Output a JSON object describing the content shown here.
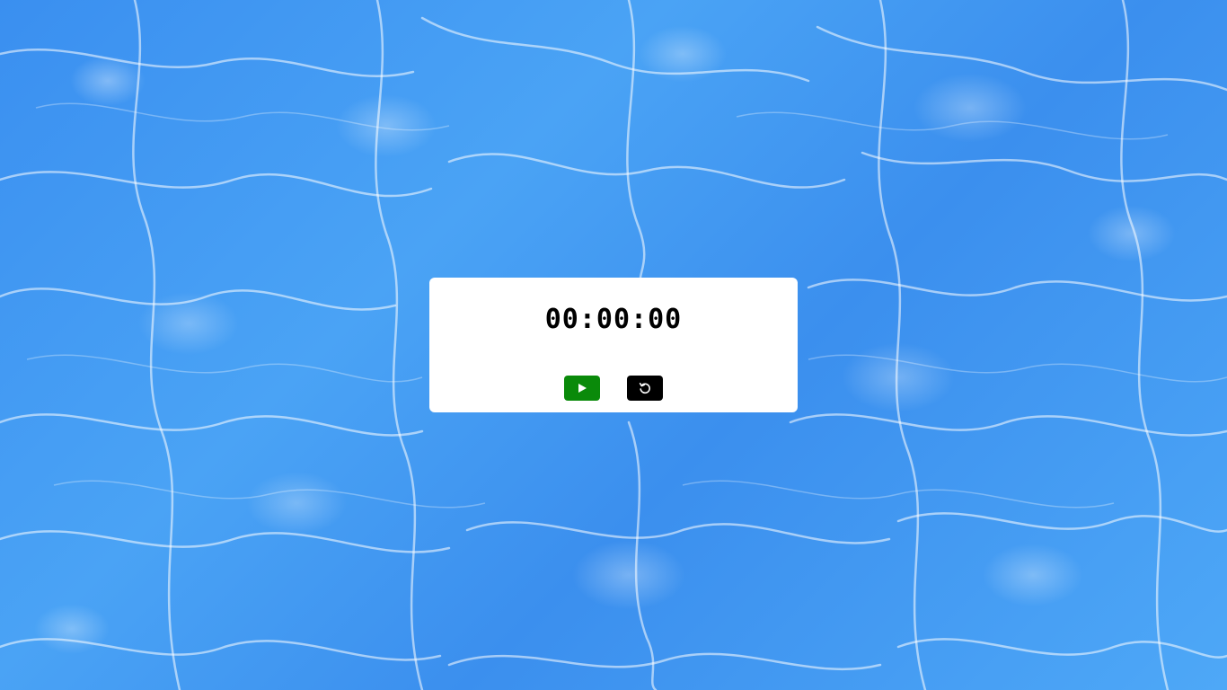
{
  "timer": {
    "display": "00:00:00"
  },
  "controls": {
    "start_icon": "play-icon",
    "reset_icon": "reset-icon",
    "start_color": "#0a8a0a",
    "reset_color": "#000000"
  },
  "background": {
    "description_icon": "water-background",
    "base_color": "#3a8ff0"
  }
}
